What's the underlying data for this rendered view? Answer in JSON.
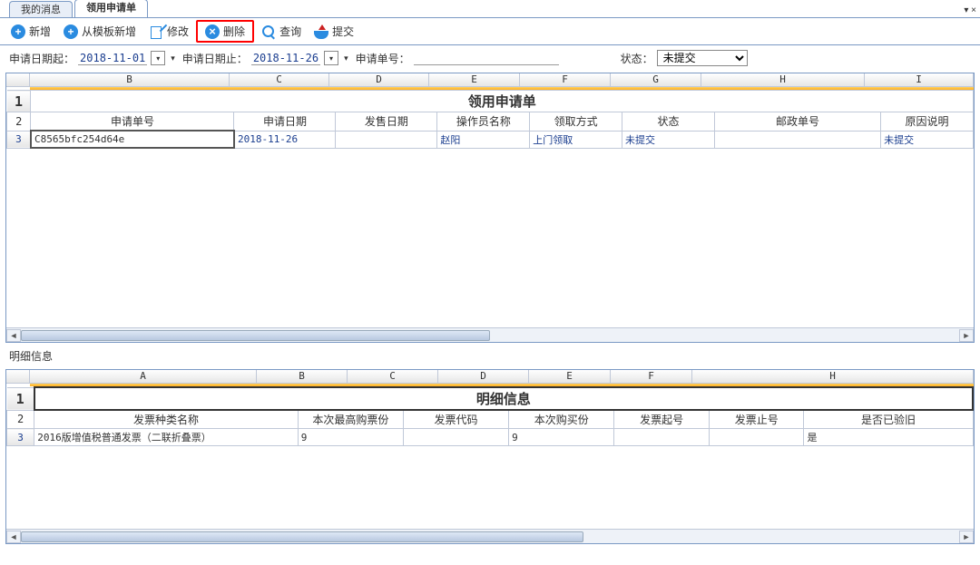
{
  "tabs": {
    "my_messages": "我的消息",
    "apply_form": "领用申请单",
    "controls": "▾ ×"
  },
  "toolbar": {
    "new": "新增",
    "new_from_template": "从模板新增",
    "edit": "修改",
    "delete": "删除",
    "query": "查询",
    "submit": "提交"
  },
  "filter": {
    "date_from_label": "申请日期起：",
    "date_from": "2018-11-01",
    "date_to_label": "申请日期止：",
    "date_to": "2018-11-26",
    "order_no_label": "申请单号：",
    "order_no": "",
    "status_label": "状态：",
    "status_value": "未提交"
  },
  "upper": {
    "letters": [
      "B",
      "C",
      "D",
      "E",
      "F",
      "G",
      "H",
      "I"
    ],
    "title": "领用申请单",
    "headers": {
      "order_no": "申请单号",
      "apply_date": "申请日期",
      "sale_date": "发售日期",
      "operator": "操作员名称",
      "method": "领取方式",
      "status": "状态",
      "postal_no": "邮政单号",
      "reason": "原因说明"
    },
    "row": {
      "order_no": "C8565bfc254d64e",
      "apply_date": "2018-11-26",
      "sale_date": "",
      "operator": "赵阳",
      "method": "上门领取",
      "status": "未提交",
      "postal_no": "",
      "reason": "未提交"
    }
  },
  "detail_label": "明细信息",
  "lower": {
    "letters": [
      "A",
      "B",
      "C",
      "D",
      "E",
      "F",
      "H"
    ],
    "title": "明细信息",
    "headers": {
      "invoice_type": "发票种类名称",
      "max_qty": "本次最高购票份",
      "invoice_code": "发票代码",
      "buy_qty": "本次购买份",
      "start_no": "发票起号",
      "end_no": "发票止号",
      "verified": "是否已验旧"
    },
    "row": {
      "invoice_type": "2016版增值税普通发票（二联折叠票）",
      "max_qty": "9",
      "invoice_code": "",
      "buy_qty": "9",
      "start_no": "",
      "end_no": "",
      "verified": "是"
    }
  }
}
